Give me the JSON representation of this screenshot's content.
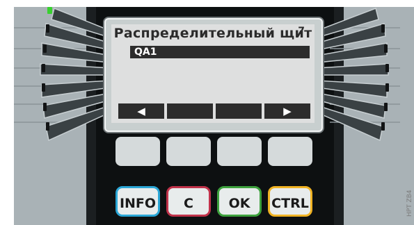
{
  "display": {
    "title": "Распределительный щит",
    "page_number": "7",
    "selected_item": "QA1",
    "softkeys": [
      {
        "label": "◀",
        "icon": "arrow-left-icon"
      },
      {
        "label": "",
        "icon": ""
      },
      {
        "label": "",
        "icon": ""
      },
      {
        "label": "▶",
        "icon": "arrow-right-icon"
      }
    ]
  },
  "function_buttons": [
    {
      "label": "INFO",
      "color": "#2aa6d6"
    },
    {
      "label": "C",
      "color": "#c0324a"
    },
    {
      "label": "OK",
      "color": "#3da13d"
    },
    {
      "label": "CTRL",
      "color": "#f0b323"
    }
  ],
  "status_led_color": "#39d12f",
  "watermark": "HPT ZB4"
}
